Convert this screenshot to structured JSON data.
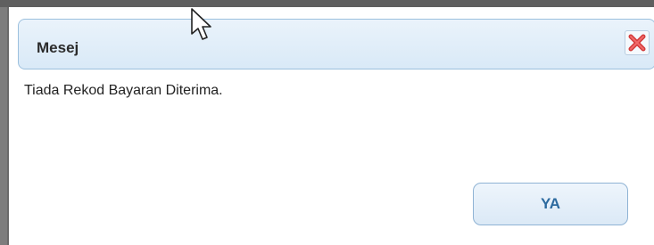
{
  "dialog": {
    "title": "Mesej",
    "message": "Tiada Rekod Bayaran Diterima.",
    "ok_label": "YA",
    "close_icon": "close-icon",
    "colors": {
      "header_bg": "#dbe9f6",
      "header_border": "#9cc0de",
      "button_text": "#2c6a9f",
      "close_red": "#d33a3a"
    }
  }
}
